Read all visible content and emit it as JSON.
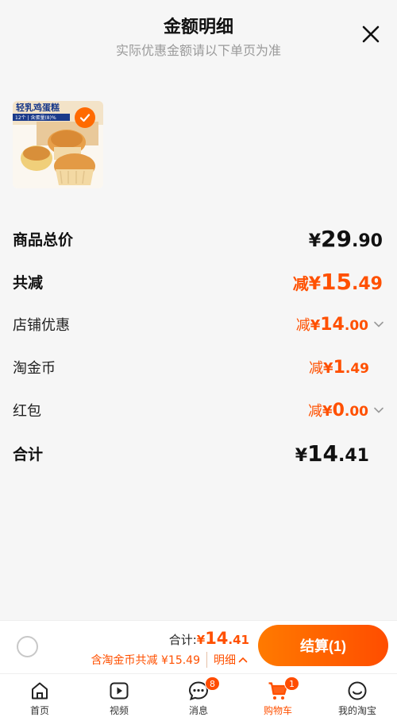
{
  "header": {
    "title": "金额明细",
    "subtitle": "实际优惠金额请以下单页为准"
  },
  "product": {
    "image_caption": "轻乳鸡蛋糕",
    "image_subcaption": "12个 | 含蛋量(8)%",
    "selected": true
  },
  "rows": {
    "total_price": {
      "label": "商品总价",
      "yen": "¥",
      "int": "29",
      "dec": ".90"
    },
    "total_reduce": {
      "label": "共减",
      "prefix": "减",
      "yen": "¥",
      "int": "15",
      "dec": ".49"
    },
    "shop_discount": {
      "label": "店铺优惠",
      "prefix": "减",
      "yen": "¥",
      "int": "14",
      "dec": ".00"
    },
    "taojinbi": {
      "label": "淘金币",
      "prefix": "减",
      "yen": "¥",
      "int": "1",
      "dec": ".49"
    },
    "red_packet": {
      "label": "红包",
      "prefix": "减",
      "yen": "¥",
      "int": "0",
      "dec": ".00"
    },
    "sum": {
      "label": "合计",
      "yen": "¥",
      "int": "14",
      "dec": ".41"
    }
  },
  "footer": {
    "sum_label": "合计:",
    "sum_yen": "¥",
    "sum_int": "14",
    "sum_dec": ".41",
    "discount_text": "含淘金币共减 ¥15.49",
    "detail_label": "明细",
    "checkout_label": "结算(1)"
  },
  "tabbar": {
    "items": [
      {
        "label": "首页",
        "icon": "home-icon"
      },
      {
        "label": "视频",
        "icon": "video-icon"
      },
      {
        "label": "消息",
        "icon": "message-icon",
        "badge": "8"
      },
      {
        "label": "购物车",
        "icon": "cart-icon",
        "badge": "1",
        "active": true
      },
      {
        "label": "我的淘宝",
        "icon": "profile-icon"
      }
    ]
  },
  "colors": {
    "accent": "#ff5000",
    "text": "#111111",
    "muted": "#9a9a9a"
  }
}
